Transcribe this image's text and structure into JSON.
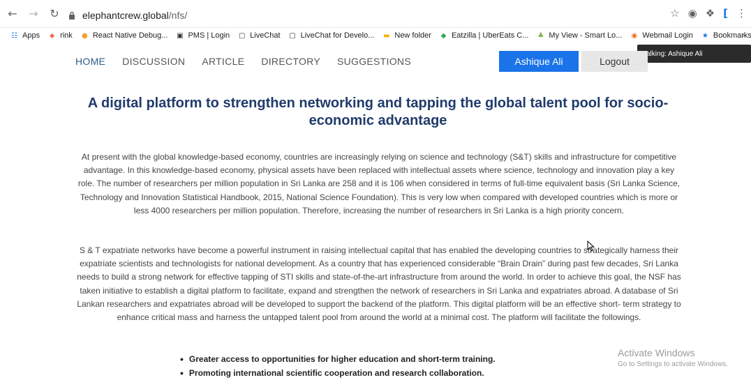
{
  "browser": {
    "url_host": "elephantcrew.global",
    "url_path": "/nfs/",
    "bookmarks": [
      {
        "label": "Apps",
        "icon": "apps-grid-icon",
        "color": "#1a73e8"
      },
      {
        "label": "rink",
        "icon": "magento-icon",
        "color": "#e44d26"
      },
      {
        "label": "React Native Debug...",
        "icon": "react-debug-icon",
        "color": "#f0a030"
      },
      {
        "label": "PMS | Login",
        "icon": "pms-icon",
        "color": "#333333"
      },
      {
        "label": "LiveChat",
        "icon": "livechat-icon",
        "color": "#333333"
      },
      {
        "label": "LiveChat for Develo...",
        "icon": "livechat-dev-icon",
        "color": "#333333"
      },
      {
        "label": "New folder",
        "icon": "folder-icon",
        "color": "#f4b400"
      },
      {
        "label": "Eatzilla | UberEats C...",
        "icon": "eatzilla-icon",
        "color": "#34a853"
      },
      {
        "label": "My View - Smart Lo...",
        "icon": "smart-icon",
        "color": "#7cb342"
      },
      {
        "label": "Webmail Login",
        "icon": "cpanel-icon",
        "color": "#f06a22"
      },
      {
        "label": "Bookmarks",
        "icon": "star-icon",
        "color": "#1a73e8"
      }
    ],
    "more": "»",
    "tooltip": "Talking: Ashique Ali"
  },
  "nav": {
    "items": [
      "HOME",
      "DISCUSSION",
      "ARTICLE",
      "DIRECTORY",
      "SUGGESTIONS"
    ],
    "user_button": "Ashique Ali",
    "logout_button": "Logout"
  },
  "hero": {
    "title": "A digital platform to strengthen networking and tapping the global talent pool for socio-economic advantage"
  },
  "content": {
    "para1": "At present with the global knowledge-based economy, countries are increasingly relying on science and technology (S&T) skills and infrastructure for competitive advantage. In this knowledge-based economy, physical assets have been replaced with intellectual assets where science, technology and innovation play a key role. The number of researchers per million population in Sri Lanka are 258 and it is 106 when considered in terms of full-time equivalent basis (Sri Lanka Science, Technology and Innovation Statistical Handbook, 2015, National Science Foundation). This is very low when compared with developed countries which is more or less 4000 researchers per million population. Therefore, increasing the number of researchers in Sri Lanka is a high priority concern.",
    "para2": "S & T expatriate networks have become a powerful instrument in raising intellectual capital that has enabled the developing countries to strategically harness their expatriate scientists and technologists for national development. As a country that has experienced considerable “Brain Drain” during past few decades, Sri Lanka needs to build a strong network for effective tapping of STI skills and state-of-the-art infrastructure from around the world. In order to achieve this goal, the NSF has taken initiative to establish a digital platform to facilitate, expand and strengthen the network of researchers in Sri Lanka and expatriates abroad. A database of Sri Lankan researchers and expatriates abroad will be developed to support the backend of the platform. This digital platform will be an effective short- term strategy to enhance critical mass and harness the untapped talent pool from around the world at a minimal cost. The platform will facilitate the followings.",
    "bullets": [
      "Greater access to opportunities for higher education and short-term training.",
      "Promoting international scientific cooperation and research collaboration."
    ]
  },
  "watermark": {
    "line1": "Activate Windows",
    "line2": "Go to Settings to activate Windows."
  },
  "colors": {
    "accent": "#1a73e8",
    "title": "#203b6b",
    "nav_active": "#2e5b84"
  }
}
